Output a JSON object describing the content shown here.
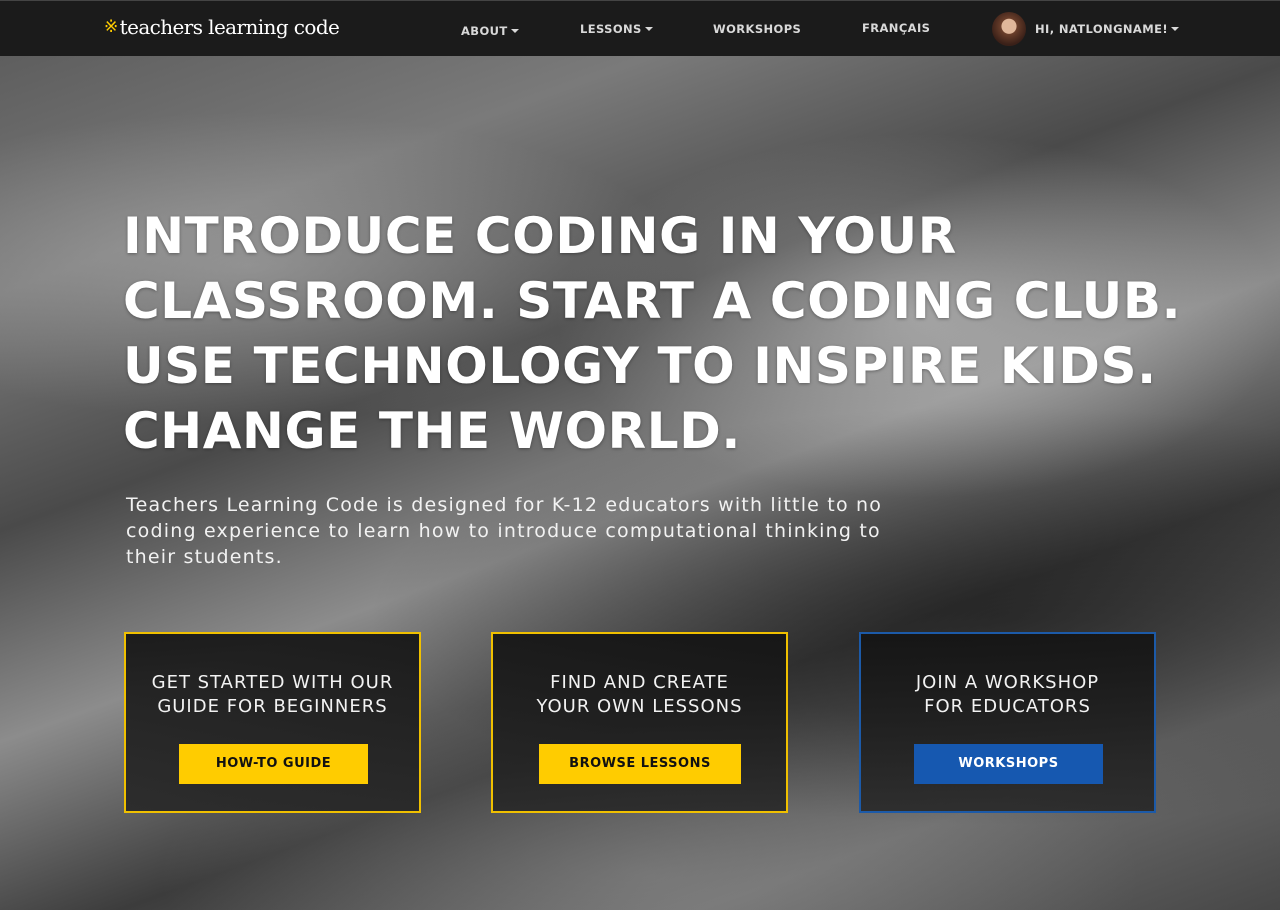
{
  "navbar": {
    "logo_text": "teachers learning code",
    "logo_mark": "※",
    "items": [
      {
        "label": "ABOUT",
        "has_dropdown": true
      },
      {
        "label": "LESSONS",
        "has_dropdown": true
      },
      {
        "label": "WORKSHOPS",
        "has_dropdown": false
      },
      {
        "label": "FRANÇAIS",
        "has_dropdown": false
      }
    ],
    "user": {
      "greeting": "HI, NATLONGNAME!",
      "has_dropdown": true
    }
  },
  "hero": {
    "headline": "INTRODUCE CODING IN YOUR CLASSROOM. START A CODING CLUB. USE TECHNOLOGY TO INSPIRE KIDS. CHANGE THE WORLD.",
    "subtext": "Teachers Learning Code is designed for K-12 educators with little to no coding experience to learn how to introduce computational thinking to their students."
  },
  "cards": [
    {
      "text": "GET STARTED WITH OUR\nGUIDE FOR BEGINNERS",
      "button_label": "HOW-TO GUIDE",
      "button_style": "yellow"
    },
    {
      "text": "FIND AND CREATE\nYOUR OWN LESSONS",
      "button_label": "BROWSE LESSONS",
      "button_style": "yellow"
    },
    {
      "text": "JOIN A WORKSHOP\nFOR EDUCATORS",
      "button_label": "WORKSHOPS",
      "button_style": "blue"
    }
  ],
  "colors": {
    "brand_yellow": "#ffcc00",
    "brand_blue": "#1658b0",
    "navbar_bg": "#1b1b1b"
  }
}
